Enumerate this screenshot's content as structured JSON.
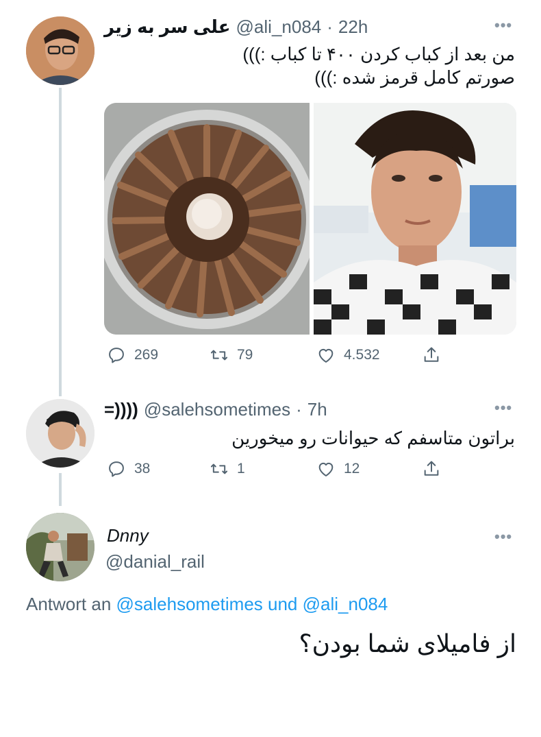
{
  "tweets": [
    {
      "display_name": "علی سر به زیر",
      "handle": "@ali_n084",
      "time": "22h",
      "text_lines": [
        "من بعد از کباب کردن ۴۰۰ تا کباب :)))",
        "صورتم کامل قرمز شده :)))"
      ],
      "replies": "269",
      "retweets": "79",
      "likes": "4.532"
    },
    {
      "display_name": "=))))",
      "handle": "@salehsometimes",
      "time": "7h",
      "text_lines": [
        "براتون متاسفم که حیوانات رو میخورین"
      ],
      "replies": "38",
      "retweets": "1",
      "likes": "12"
    }
  ],
  "focused_tweet": {
    "display_name": "Dnny",
    "handle": "@danial_rail",
    "reply_prefix": "Antwort an",
    "reply_user_1": "@salehsometimes",
    "reply_and": "und",
    "reply_user_2": "@ali_n084",
    "text": "از فامیلای شما بودن؟"
  },
  "colors": {
    "link": "#1d9bf0",
    "muted": "#536471",
    "thread_line": "#cfd9de"
  },
  "icons": [
    "more-icon",
    "reply-icon",
    "retweet-icon",
    "like-icon",
    "share-icon"
  ]
}
